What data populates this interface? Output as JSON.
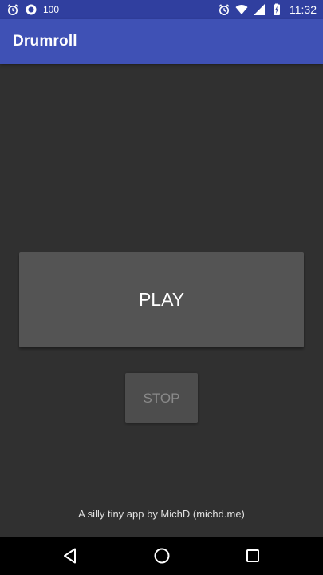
{
  "status_bar": {
    "battery_level_text": "100",
    "time": "11:32",
    "background": "#303f9f",
    "icons": [
      "alarm-icon",
      "circle-notification-icon",
      "alarm-icon",
      "wifi-icon",
      "cell-signal-icon",
      "battery-charging-icon"
    ]
  },
  "app_bar": {
    "title": "Drumroll",
    "color": "#3f51b5"
  },
  "main": {
    "play_label": "PLAY",
    "stop_label": "STOP",
    "stop_enabled": false,
    "credit_text": "A silly tiny app by MichD (michd.me)"
  },
  "nav_bar": {
    "buttons": [
      "back-icon",
      "home-icon",
      "recents-icon"
    ]
  }
}
